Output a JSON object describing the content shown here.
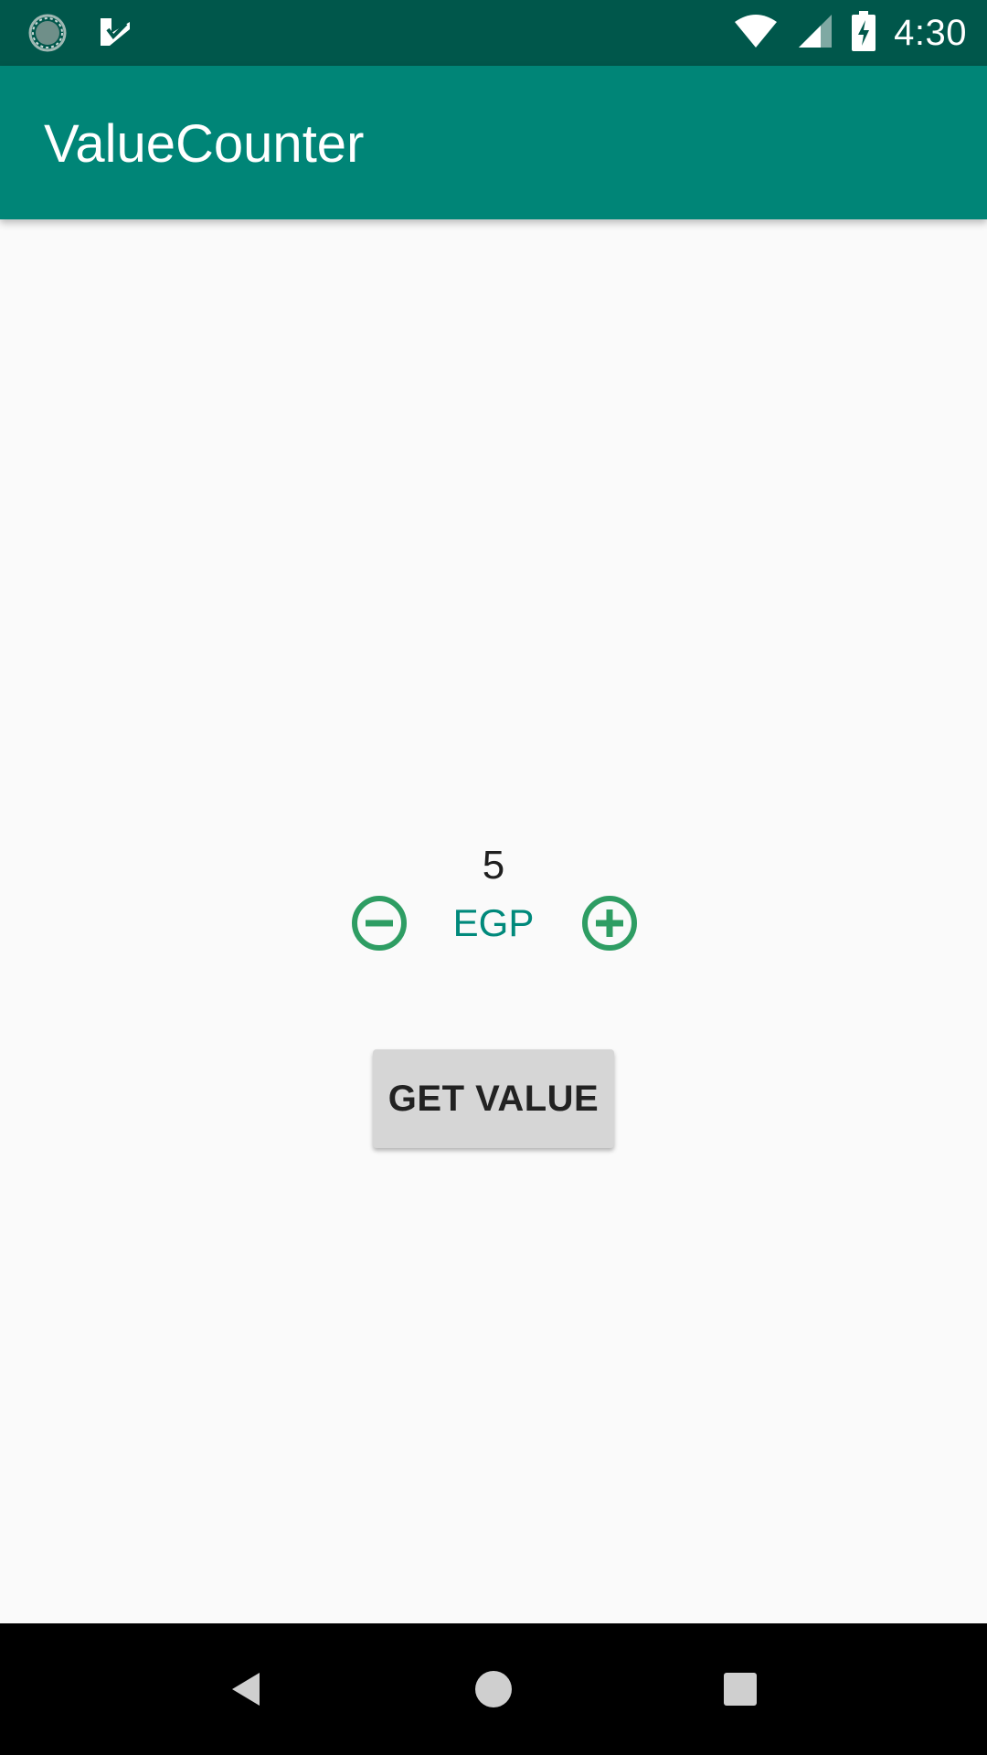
{
  "status_bar": {
    "time": "4:30",
    "left_icons": [
      "sync-icon",
      "app-notification-icon"
    ],
    "right_icons": [
      "wifi-icon",
      "cell-signal-icon",
      "battery-charging-icon"
    ]
  },
  "app_bar": {
    "title": "ValueCounter"
  },
  "counter": {
    "value": "5",
    "currency": "EGP",
    "decrement_icon": "minus-circle-icon",
    "increment_icon": "plus-circle-icon"
  },
  "actions": {
    "get_value_label": "GET VALUE"
  },
  "navigation": {
    "buttons": [
      "back-icon",
      "home-icon",
      "recents-icon"
    ]
  },
  "colors": {
    "status_bar": "#00574b",
    "app_bar": "#008577",
    "accent": "#2e9d63",
    "currency_text": "#00897b",
    "background": "#fafafa"
  }
}
